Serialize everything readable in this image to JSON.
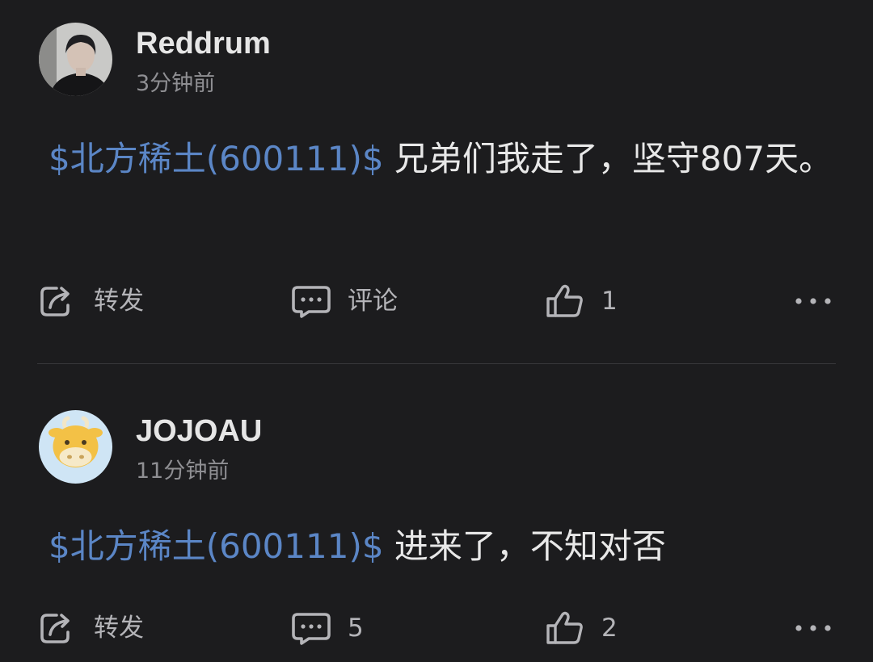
{
  "posts": [
    {
      "username": "Reddrum",
      "time": "3分钟前",
      "stock_tag": "$北方稀土(600111)$",
      "text": " 兄弟们我走了，坚守807天。",
      "actions": {
        "share_label": "转发",
        "comment_label": "评论",
        "like_count": "1"
      }
    },
    {
      "username": "JOJOAU",
      "time": "11分钟前",
      "stock_tag": "$北方稀土(600111)$",
      "text": " 进来了，不知对否",
      "actions": {
        "share_label": "转发",
        "comment_label": "5",
        "like_count": "2"
      }
    }
  ],
  "colors": {
    "background": "#1c1c1e",
    "stock_link": "#5b86c6",
    "text_primary": "#e8e8e8",
    "text_secondary": "#8f8f93",
    "divider": "#38383b"
  },
  "icons": {
    "share": "share-icon",
    "comment": "comment-icon",
    "like": "thumbs-up-icon",
    "more": "more-icon"
  }
}
